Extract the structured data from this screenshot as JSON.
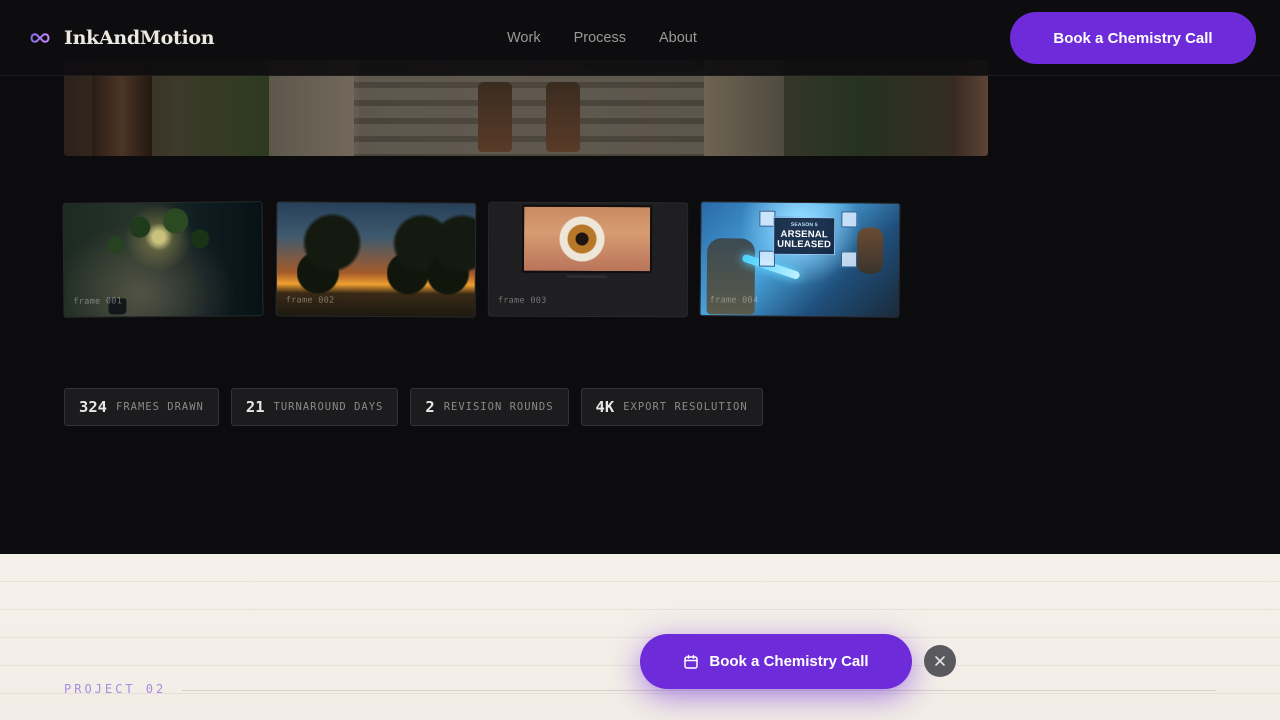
{
  "header": {
    "brand_name": "InkAndMotion",
    "brand_icon": "infinity-icon",
    "nav": [
      {
        "label": "Work"
      },
      {
        "label": "Process"
      },
      {
        "label": "About"
      }
    ],
    "cta_label": "Book a Chemistry Call"
  },
  "frames": [
    {
      "label": "frame 001"
    },
    {
      "label": "frame 002"
    },
    {
      "label": "frame 003"
    },
    {
      "label": "frame 004",
      "art_title": [
        "SEASON 5",
        "ARSENAL",
        "UNLEASED"
      ]
    }
  ],
  "stats": [
    {
      "value": "324",
      "label": "frames drawn"
    },
    {
      "value": "21",
      "label": "turnaround days"
    },
    {
      "value": "2",
      "label": "revision rounds"
    },
    {
      "value": "4K",
      "label": "export resolution"
    }
  ],
  "project": {
    "label": "PROJECT 02"
  },
  "floating_cta": {
    "label": "Book a Chemistry Call",
    "icon": "calendar-icon"
  },
  "close_icon": "close-icon",
  "colors": {
    "accent": "#6d2bd9",
    "dark_bg": "#0c0b0d",
    "light_bg": "#f4efe9",
    "project_label": "#a98be0"
  }
}
